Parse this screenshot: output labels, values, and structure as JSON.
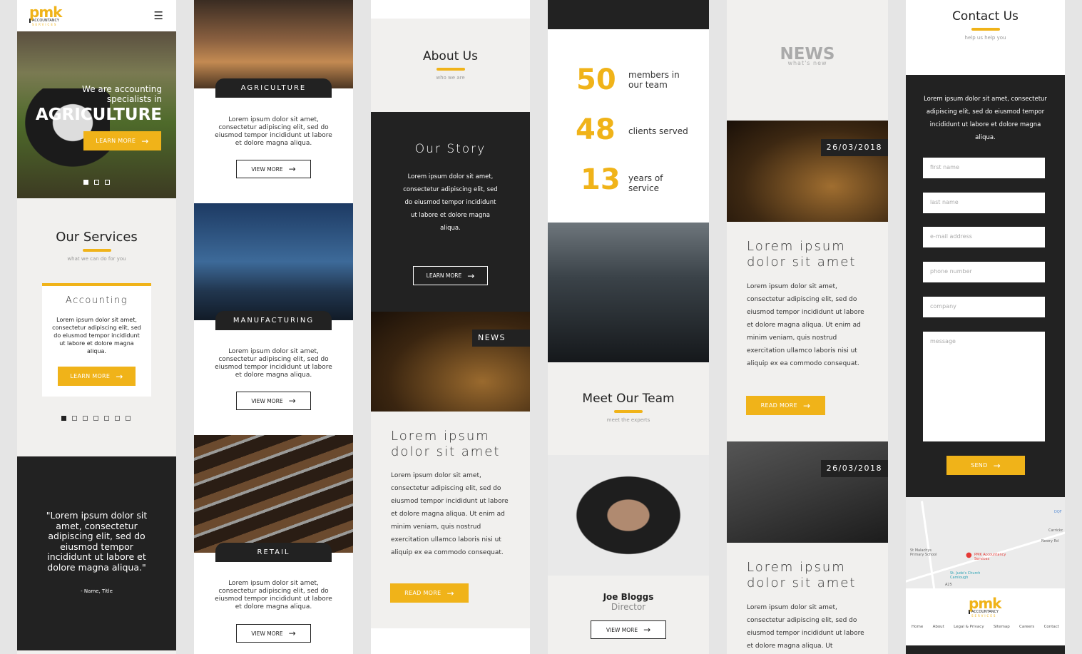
{
  "colors": {
    "accent": "#f0b319",
    "dark": "#222222",
    "light": "#f1f0ee"
  },
  "logo": {
    "main": "pmk",
    "line1": "ACCOUNTANCY",
    "line2": "SERVICES"
  },
  "col1": {
    "menu_icon": "hamburger-icon",
    "hero": {
      "line1": "We are accounting",
      "line2": "specialists in",
      "title": "AGRICULTURE",
      "button": "LEARN MORE",
      "slides": 3,
      "active_slide": 1
    },
    "services": {
      "title": "Our Services",
      "subtitle": "what we can do for you",
      "card_title": "Accounting",
      "card_text": "Lorem ipsum dolor sit amet, consectetur adipiscing elit, sed do eiusmod tempor incididunt ut labore et dolore magna aliqua.",
      "button": "LEARN MORE",
      "slides": 7,
      "active_slide": 1
    },
    "quote": {
      "text": "\"Lorem ipsum dolor sit amet, consectetur adipiscing elit, sed do eiusmod tempor incididunt ut labore et dolore magna aliqua.\"",
      "author": "- Name, Title"
    }
  },
  "col2": {
    "sectors": [
      {
        "label": "AGRICULTURE",
        "text": "Lorem ipsum dolor sit amet, consectetur adipiscing elit, sed do eiusmod tempor incididunt ut labore et dolore magna aliqua.",
        "button": "VIEW MORE"
      },
      {
        "label": "MANUFACTURING",
        "text": "Lorem ipsum dolor sit amet, consectetur adipiscing elit, sed do eiusmod tempor incididunt ut labore et dolore magna aliqua.",
        "button": "VIEW MORE"
      },
      {
        "label": "RETAIL",
        "text": "Lorem ipsum dolor sit amet, consectetur adipiscing elit, sed do eiusmod tempor incididunt ut labore et dolore magna aliqua.",
        "button": "VIEW MORE"
      }
    ]
  },
  "col3": {
    "about": {
      "title": "About Us",
      "subtitle": "who we are"
    },
    "story": {
      "title": "Our Story",
      "text": "Lorem ipsum dolor sit amet, consectetur adipiscing elit, sed do eiusmod tempor incididunt ut labore et dolore magna aliqua.",
      "button": "LEARN MORE"
    },
    "news_tag": "NEWS",
    "article": {
      "title1": "Lorem ipsum",
      "title2": "dolor sit amet",
      "text": "Lorem ipsum dolor sit amet, consectetur adipiscing elit, sed do eiusmod tempor incididunt ut labore et dolore magna aliqua. Ut enim ad minim veniam, quis nostrud exercitation ullamco laboris nisi ut aliquip ex ea commodo consequat.",
      "button": "READ MORE"
    }
  },
  "col4": {
    "stats": [
      {
        "value": "50",
        "l1": "members in",
        "l2": "our team"
      },
      {
        "value": "48",
        "l1": "clients served",
        "l2": ""
      },
      {
        "value": "13",
        "l1": "years of",
        "l2": "service"
      }
    ],
    "team": {
      "title": "Meet Our Team",
      "subtitle": "meet the experts"
    },
    "member": {
      "name": "Joe Bloggs",
      "role": "Director",
      "button": "VIEW MORE"
    }
  },
  "col5": {
    "header": {
      "title": "NEWS",
      "subtitle": "what's new"
    },
    "posts": [
      {
        "date": "26/03/2018",
        "title1": "Lorem ipsum",
        "title2": "dolor sit amet",
        "text": "Lorem ipsum dolor sit amet, consectetur adipiscing elit, sed do eiusmod tempor incididunt ut labore et dolore magna aliqua. Ut enim ad minim veniam, quis nostrud exercitation ullamco laboris nisi ut aliquip ex ea commodo consequat.",
        "button": "READ MORE"
      },
      {
        "date": "26/03/2018",
        "title1": "Lorem ipsum",
        "title2": "dolor sit amet",
        "text": "Lorem ipsum dolor sit amet, consectetur adipiscing elit, sed do eiusmod tempor incididunt ut labore et dolore magna aliqua. Ut"
      }
    ]
  },
  "col6": {
    "title": "Contact Us",
    "subtitle": "help us help you",
    "intro": "Lorem ipsum dolor sit amet, consectetur adipiscing elit, sed do eiusmod tempor incididunt ut labore et dolore magna aliqua.",
    "placeholders": {
      "first": "first name",
      "last": "last name",
      "email": "e-mail address",
      "phone": "phone number",
      "company": "company",
      "message": "message"
    },
    "send": "SEND",
    "map": {
      "marker": "PMK Accountancy Services",
      "school": "St Malachys Primary School",
      "church": "St. Jude's Church Camlough",
      "road": "Newry Rd",
      "road2": "A25",
      "dqf": "DQF",
      "carrick": "Carrickc"
    },
    "footer_links": [
      "Home",
      "About",
      "Legal & Privacy",
      "Sitemap",
      "Careers",
      "Contact"
    ]
  }
}
